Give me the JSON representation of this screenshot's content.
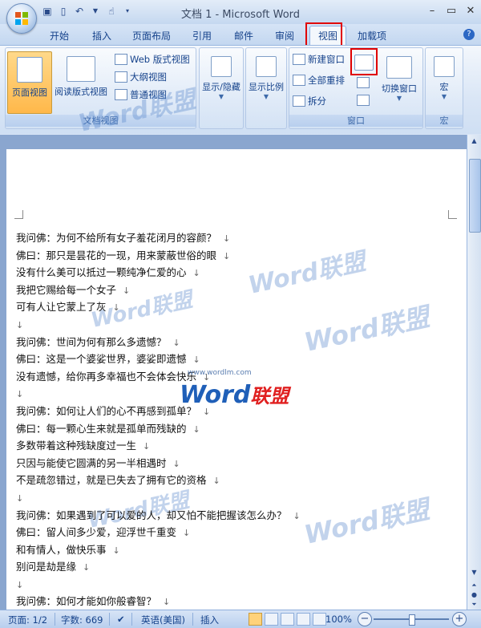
{
  "window": {
    "title": "文档 1 - Microsoft Word",
    "controls": [
      "minimize-icon",
      "restore-icon",
      "close-icon"
    ]
  },
  "quick_access": [
    "save-icon",
    "new-doc-icon",
    "undo-icon",
    "format-painter-icon"
  ],
  "tabs": [
    {
      "label": "开始"
    },
    {
      "label": "插入"
    },
    {
      "label": "页面布局"
    },
    {
      "label": "引用"
    },
    {
      "label": "邮件"
    },
    {
      "label": "审阅"
    },
    {
      "label": "视图",
      "active": true
    },
    {
      "label": "加载项"
    }
  ],
  "ribbon": {
    "doc_views": {
      "label": "文档视图",
      "page_view": "页面视图",
      "reading_view": "阅读版式视图",
      "web_view": "Web 版式视图",
      "outline_view": "大纲视图",
      "draft_view": "普通视图"
    },
    "show_hide": {
      "label": "显示/隐藏"
    },
    "zoom": {
      "label": "显示比例"
    },
    "window": {
      "label": "窗口",
      "new_window": "新建窗口",
      "arrange_all": "全部重排",
      "split": "拆分",
      "switch_windows": "切换窗口"
    },
    "macros": {
      "label": "宏",
      "button": "宏"
    }
  },
  "document": {
    "lines": [
      "我问佛：为何不给所有女子羞花闭月的容颜？",
      "佛曰：那只是昙花的一现，用来蒙蔽世俗的眼",
      "没有什么美可以抵过一颗纯净仁爱的心",
      "我把它赐给每一个女子",
      "可有人让它蒙上了灰",
      "",
      "我问佛：世间为何有那么多遗憾？",
      "佛曰：这是一个婆娑世界，婆娑即遗憾",
      "没有遗憾，给你再多幸福也不会体会快乐",
      "",
      "我问佛：如何让人们的心不再感到孤单？",
      "佛曰：每一颗心生来就是孤单而残缺的",
      "多数带着这种残缺度过一生",
      "只因与能使它圆满的另一半相遇时",
      "不是疏忽错过，就是已失去了拥有它的资格",
      "",
      "我问佛：如果遇到了可以爱的人，却又怕不能把握该怎么办？",
      "佛曰：留人间多少爱，迎浮世千重变",
      "和有情人，做快乐事",
      "别问是劫是缘",
      "",
      "我问佛：如何才能如你般睿智？"
    ],
    "paragraph_mark": "↓"
  },
  "watermark": {
    "url": "www.wordlm.com",
    "brand_en": "Word",
    "brand_cn": "联盟"
  },
  "status_bar": {
    "page": "页面: 1/2",
    "words": "字数: 669",
    "language": "英语(美国)",
    "mode": "插入",
    "zoom": "100%",
    "zoom_level": 1.0
  },
  "colors": {
    "highlight_box": "#e00000",
    "ribbon_text": "#15428b"
  }
}
